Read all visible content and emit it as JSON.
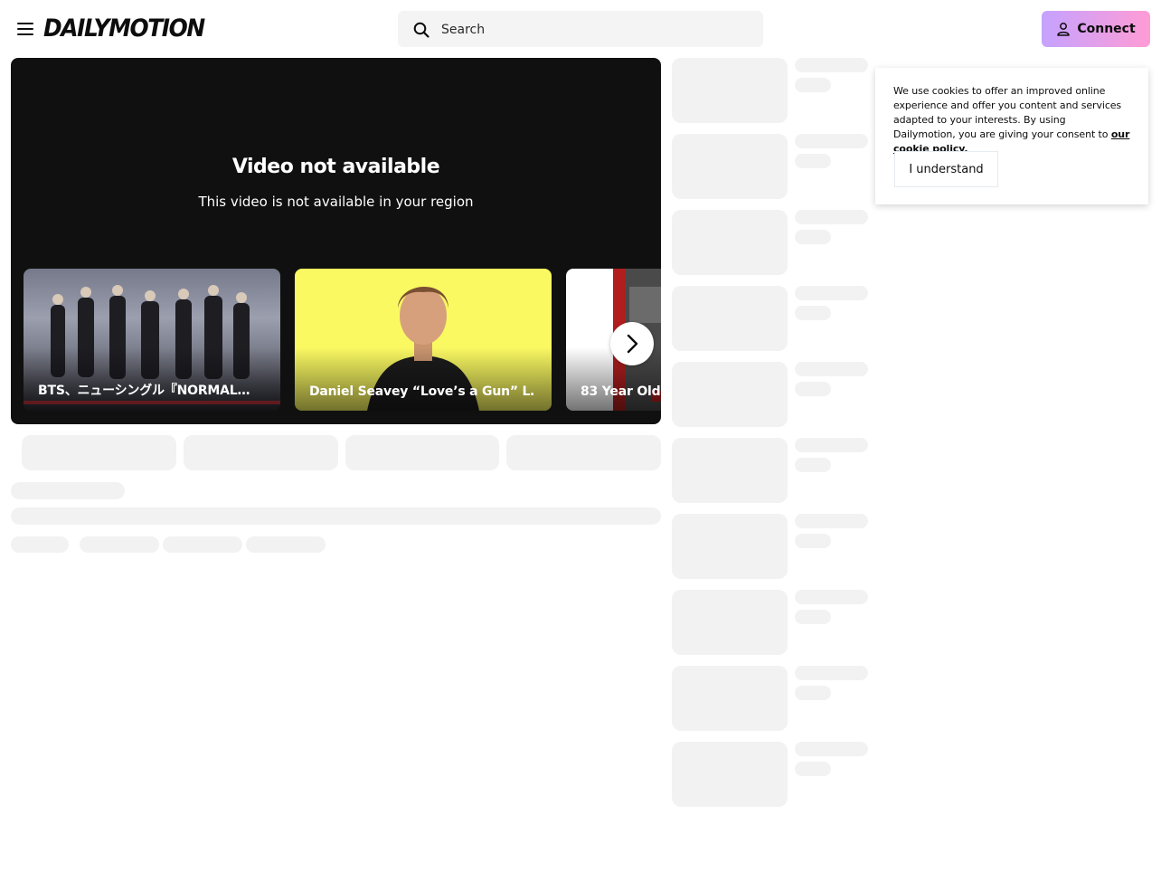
{
  "header": {
    "logo": "DAILYMOTION",
    "search_placeholder": "Search",
    "connect_label": "Connect"
  },
  "player": {
    "title": "Video not available",
    "message": "This video is not available in your region",
    "cards": [
      {
        "label": "BTS、ニューシングル『NORMAL…"
      },
      {
        "label": "Daniel Seavey “Love’s a Gun” L…"
      },
      {
        "label": "83 Year Old"
      }
    ]
  },
  "cookie": {
    "text": "We use cookies to offer an improved online experience and offer you content and services adapted to your interests. By using Dailymotion, you are giving your consent to",
    "link": "our cookie policy.",
    "button": "I understand"
  },
  "icons": {
    "menu": "hamburger-icon",
    "search": "search-icon",
    "connect": "user-icon",
    "next": "chevron-right-icon"
  }
}
